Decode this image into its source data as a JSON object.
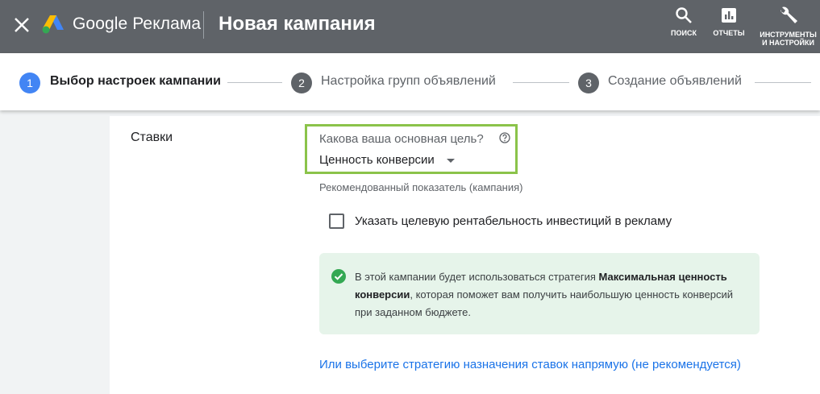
{
  "header": {
    "brand": "Google Реклама",
    "title": "Новая кампания",
    "search_label": "ПОИСК",
    "reports_label": "ОТЧЕТЫ",
    "tools_label_line1": "ИНСТРУМЕНТЫ",
    "tools_label_line2": "И НАСТРОЙКИ"
  },
  "steps": [
    {
      "num": "1",
      "label": "Выбор настроек кампании",
      "state": "active"
    },
    {
      "num": "2",
      "label": "Настройка групп объявлений",
      "state": "pending"
    },
    {
      "num": "3",
      "label": "Создание объявлений",
      "state": "pending"
    }
  ],
  "bids": {
    "section_label": "Ставки",
    "goal_question": "Какова ваша основная цель?",
    "goal_value": "Ценность конверсии",
    "recommended": "Рекомендованный показатель (кампания)",
    "checkbox_label": "Указать целевую рентабельность инвестиций в рекламу",
    "checkbox_checked": false,
    "info_part1": "В этой кампании будет использоваться стратегия ",
    "info_bold": "Максимальная ценность конверсии",
    "info_part2": ", которая поможет вам получить наибольшую ценность конверсий при заданном бюджете.",
    "link": "Или выберите стратегию назначения ставок напрямую (не рекомендуется)"
  },
  "colors": {
    "topbar": "#5f6368",
    "active_step": "#4285f4",
    "pending_step": "#5f6368",
    "highlight_border": "#8bc34a",
    "info_bg": "#e6f4ea",
    "check_green": "#34a853",
    "link": "#1a73e8"
  }
}
